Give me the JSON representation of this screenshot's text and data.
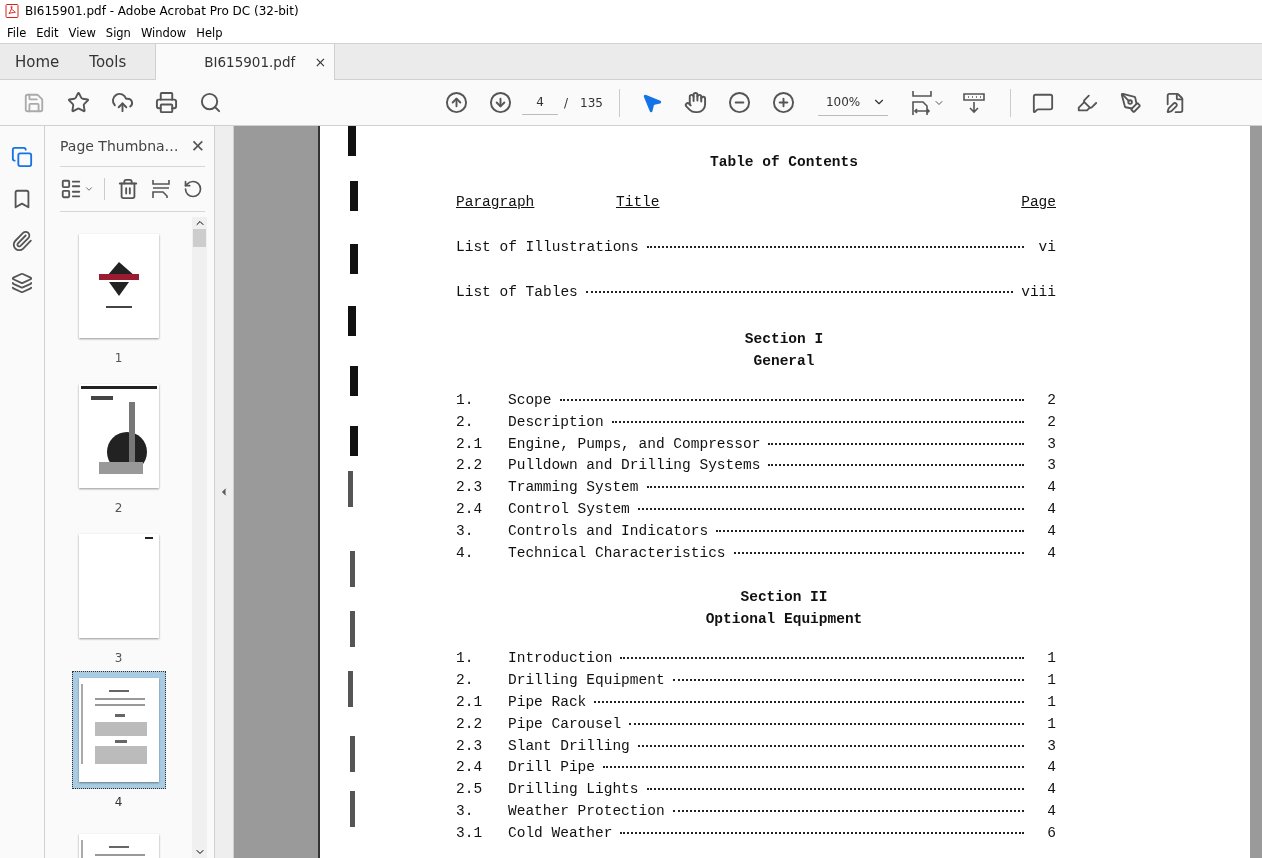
{
  "window": {
    "title": "BI615901.pdf - Adobe Acrobat Pro DC (32-bit)"
  },
  "menu": [
    "File",
    "Edit",
    "View",
    "Sign",
    "Window",
    "Help"
  ],
  "tabs": [
    {
      "label": "Home",
      "kind": "nav",
      "selected": false
    },
    {
      "label": "Tools",
      "kind": "nav",
      "selected": false
    },
    {
      "label": "BI615901.pdf",
      "kind": "document",
      "selected": true,
      "close": "×"
    }
  ],
  "toolbar": {
    "page": {
      "value": "4",
      "separator": "/",
      "total": "135"
    },
    "zoom": "100%"
  },
  "rail": [
    {
      "kind": "pages",
      "selected": true
    },
    {
      "kind": "bookmarks",
      "selected": false
    },
    {
      "kind": "attachments",
      "selected": false
    },
    {
      "kind": "layers",
      "selected": false
    }
  ],
  "panel": {
    "title": "Page Thumbna…",
    "close": "✕",
    "thumbnails": [
      {
        "label": "1",
        "kind": "cover",
        "selected": false
      },
      {
        "label": "2",
        "selected": false
      },
      {
        "label": "3",
        "kind": "blank",
        "selected": false
      },
      {
        "label": "4",
        "kind": "text",
        "selected": true
      },
      {
        "kind": "text",
        "selected": false
      }
    ]
  },
  "document": {
    "title": "Table of Contents",
    "columns": [
      "Paragraph",
      "Title",
      "Page"
    ],
    "lists": [
      {
        "title": "List of Illustrations",
        "page": "vi"
      },
      {
        "title": "List of Tables",
        "page": "viii"
      }
    ],
    "sections": [
      {
        "heading": "Section I",
        "subheading": "General",
        "entries": [
          {
            "number": "1.",
            "title": "Scope",
            "page": "2"
          },
          {
            "number": "2.",
            "title": "Description",
            "page": "2"
          },
          {
            "number": "2.1",
            "title": "Engine, Pumps, and Compressor",
            "page": "3"
          },
          {
            "number": "2.2",
            "title": "Pulldown and Drilling Systems",
            "page": "3"
          },
          {
            "number": "2.3",
            "title": "Tramming System",
            "page": "4"
          },
          {
            "number": "2.4",
            "title": "Control System",
            "page": "4"
          },
          {
            "number": "3.",
            "title": "Controls and Indicators",
            "page": "4"
          },
          {
            "number": "4.",
            "title": "Technical Characteristics",
            "page": "4"
          }
        ]
      },
      {
        "heading": "Section II",
        "subheading": "Optional Equipment",
        "entries": [
          {
            "number": "1.",
            "title": "Introduction",
            "page": "1"
          },
          {
            "number": "2.",
            "title": "Drilling Equipment",
            "page": "1"
          },
          {
            "number": "2.1",
            "title": "Pipe Rack",
            "page": "1"
          },
          {
            "number": "2.2",
            "title": "Pipe Carousel",
            "page": "1"
          },
          {
            "number": "2.3",
            "title": "Slant Drilling",
            "page": "3"
          },
          {
            "number": "2.4",
            "title": "Drill Pipe",
            "page": "4"
          },
          {
            "number": "2.5",
            "title": "Drilling Lights",
            "page": "4"
          },
          {
            "number": "3.",
            "title": "Weather Protection",
            "page": "4"
          },
          {
            "number": "3.1",
            "title": "Cold Weather",
            "page": "6"
          }
        ]
      }
    ]
  }
}
